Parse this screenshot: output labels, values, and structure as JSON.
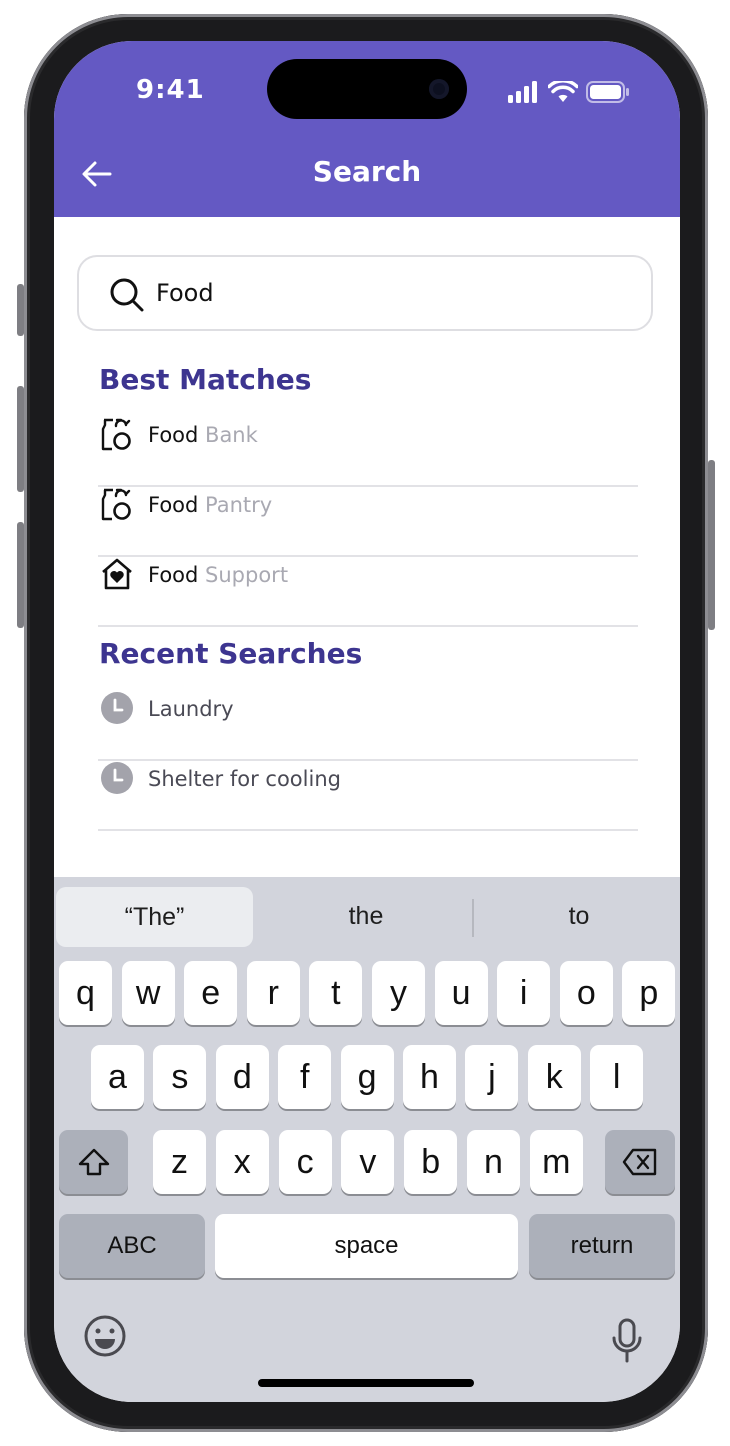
{
  "status_bar": {
    "time": "9:41"
  },
  "header": {
    "title": "Search"
  },
  "search": {
    "value": "Food"
  },
  "best_matches": {
    "heading": "Best Matches",
    "items": [
      {
        "bold": "Food",
        "rest": " Bank",
        "icon": "food-bank-icon"
      },
      {
        "bold": "Food",
        "rest": " Pantry",
        "icon": "food-bank-icon"
      },
      {
        "bold": "Food",
        "rest": " Support",
        "icon": "heart-home-icon"
      }
    ]
  },
  "recent_searches": {
    "heading": "Recent Searches",
    "items": [
      {
        "label": "Laundry"
      },
      {
        "label": "Shelter for cooling"
      }
    ]
  },
  "keyboard": {
    "suggestions": [
      "“The”",
      "the",
      "to"
    ],
    "row1": [
      "q",
      "w",
      "e",
      "r",
      "t",
      "y",
      "u",
      "i",
      "o",
      "p"
    ],
    "row2": [
      "a",
      "s",
      "d",
      "f",
      "g",
      "h",
      "j",
      "k",
      "l"
    ],
    "row3": [
      "z",
      "x",
      "c",
      "v",
      "b",
      "n",
      "m"
    ],
    "abc": "ABC",
    "space": "space",
    "return": "return"
  },
  "colors": {
    "header": "#6459c3",
    "heading": "#3d3590"
  }
}
